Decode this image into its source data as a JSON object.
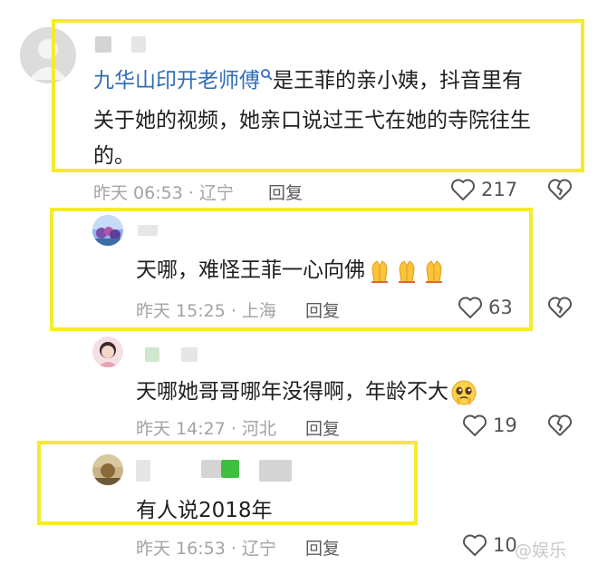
{
  "comments": [
    {
      "mention": "九华山印开老师傅",
      "text_line1_rest": "是王菲的亲小姨，抖音里有",
      "text_line2": "关于她的视频，她亲口说过王弋在她的寺院往生",
      "text_line3": "的。",
      "time": "昨天 06:53 · 辽宁",
      "reply": "回复",
      "likes": "217"
    },
    {
      "text": "天哪，难怪王菲一心向佛",
      "time": "昨天 15:25 · 上海",
      "reply": "回复",
      "likes": "63"
    },
    {
      "text": "天哪她哥哥哪年没得啊，年龄不大",
      "time": "昨天 14:27 · 河北",
      "reply": "回复",
      "likes": "19"
    },
    {
      "text": "有人说2018年",
      "time": "昨天 16:53 · 辽宁",
      "reply": "回复",
      "likes": "10"
    }
  ],
  "watermark": "@娱乐",
  "icons": {
    "like": "heart-icon",
    "dislike": "broken-heart-icon",
    "search": "search-icon",
    "pray": "folded-hands-emoji",
    "pleading": "pleading-face-emoji"
  },
  "colors": {
    "highlight": "#f5ea2f",
    "link": "#2f6db5",
    "meta": "#a3a3a3"
  }
}
